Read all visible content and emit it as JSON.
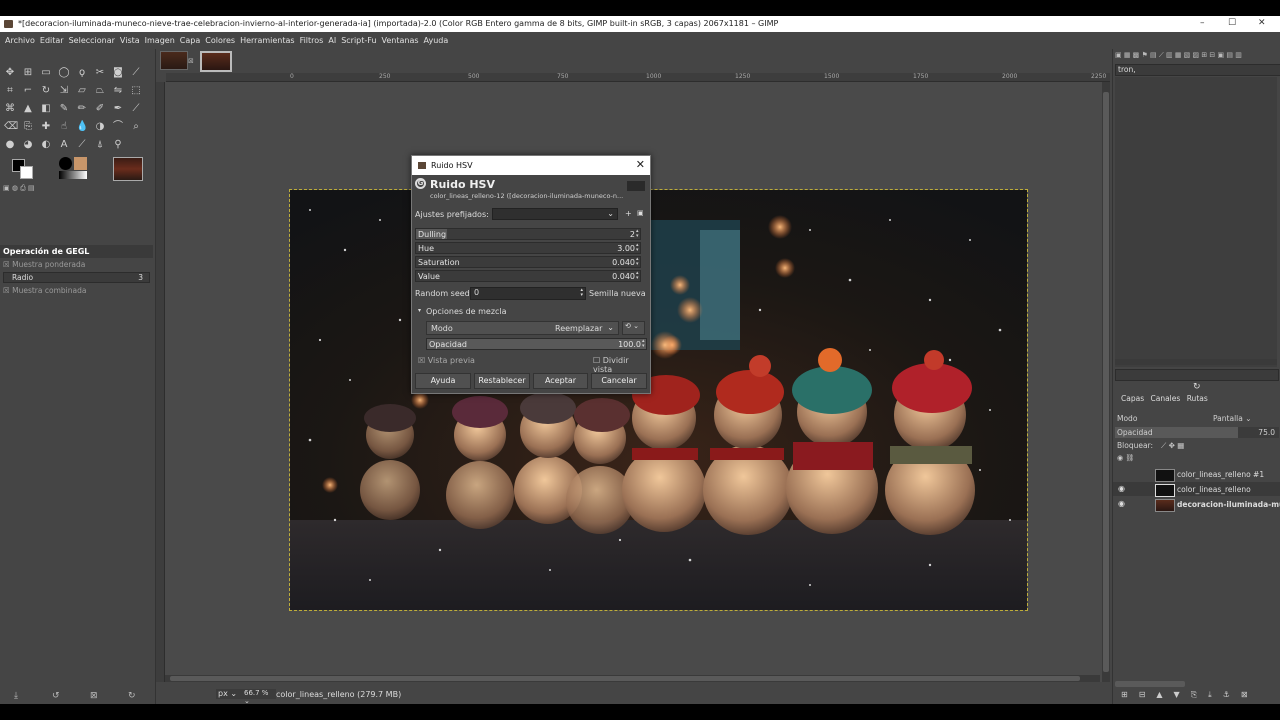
{
  "window": {
    "title": "*[decoracion-iluminada-muneco-nieve-trae-celebracion-invierno-al-interior-generada-ia] (importada)-2.0 (Color RGB Entero gamma de 8 bits, GIMP built-in sRGB, 3 capas) 2067x1181 – GIMP",
    "minimize": "–",
    "maximize": "☐",
    "close": "✕"
  },
  "menu": [
    "Archivo",
    "Editar",
    "Seleccionar",
    "Vista",
    "Imagen",
    "Capa",
    "Colores",
    "Herramientas",
    "Filtros",
    "AI",
    "Script-Fu",
    "Ventanas",
    "Ayuda"
  ],
  "tool_options": {
    "title": "Operación de GEGL",
    "sample_weighted": "Muestra ponderada",
    "radius_label": "Radio",
    "radius_value": "3",
    "sample_merged": "Muestra combinada"
  },
  "ruler": {
    "ticks": [
      "0",
      "250",
      "500",
      "750",
      "1000",
      "1250",
      "1500",
      "1750",
      "2000",
      "2250"
    ]
  },
  "status": {
    "unit": "px",
    "zoom": "66.7 %",
    "info": "color_lineas_relleno (279.7 MB)"
  },
  "brush_dock": {
    "brush_name": "tron,"
  },
  "layers_dock": {
    "tabs": [
      "Capas",
      "Canales",
      "Rutas"
    ],
    "mode_label": "Modo",
    "mode_value": "Pantalla",
    "opacity_label": "Opacidad",
    "opacity_value": "75.0",
    "opacity_fraction": 0.75,
    "lock_label": "Bloquear:",
    "layers": [
      {
        "name": "color_lineas_relleno #1",
        "visible": false,
        "bold": false
      },
      {
        "name": "color_lineas_relleno",
        "visible": true,
        "bold": false
      },
      {
        "name": "decoracion-iluminada-mune",
        "visible": true,
        "bold": true
      }
    ]
  },
  "dialog": {
    "window_title": "Ruido HSV",
    "heading": "Ruido HSV",
    "subtitle": "color_lineas_relleno-12 ([decoracion-iluminada-muneco-n...",
    "presets_label": "Ajustes prefijados:",
    "presets_value": "",
    "params": [
      {
        "label": "Dulling",
        "value": "2",
        "fraction": 0.14
      },
      {
        "label": "Hue",
        "value": "3.00",
        "fraction": 0.0
      },
      {
        "label": "Saturation",
        "value": "0.040",
        "fraction": 0.0
      },
      {
        "label": "Value",
        "value": "0.040",
        "fraction": 0.0
      }
    ],
    "seed_label": "Random seed",
    "seed_value": "0",
    "new_seed": "Semilla nueva",
    "blend_section": "Opciones de mezcla",
    "mode_label": "Modo",
    "mode_value": "Reemplazar",
    "opacity_label": "Opacidad",
    "opacity_value": "100.0",
    "preview_label": "Vista previa",
    "split_label": "Dividir vista",
    "buttons": {
      "help": "Ayuda",
      "reset": "Restablecer",
      "ok": "Aceptar",
      "cancel": "Cancelar"
    }
  },
  "colors": {
    "panel": "#454545",
    "selection_border": "#bfae3a"
  }
}
